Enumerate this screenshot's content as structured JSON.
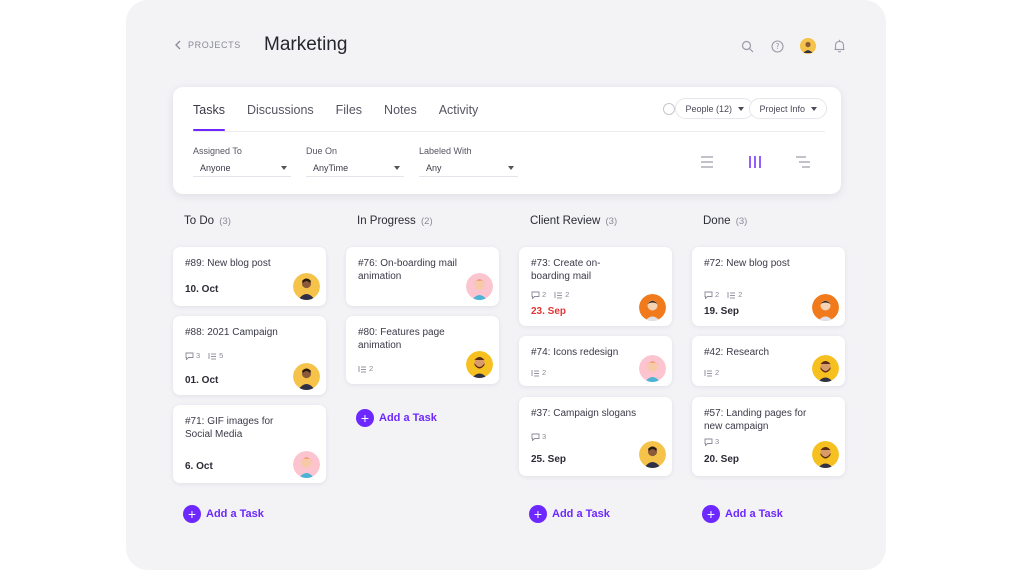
{
  "header": {
    "back_label": "PROJECTS",
    "title": "Marketing"
  },
  "colors": {
    "accent": "#6d28ff",
    "overdue": "#e43535",
    "panel_bg": "#f3f3f6"
  },
  "icons": [
    "search-icon",
    "help-icon",
    "user-avatar",
    "bell-icon",
    "chevron-left-icon",
    "clock-icon",
    "list-view-icon",
    "board-view-icon",
    "timeline-view-icon",
    "comment-icon",
    "subtask-icon",
    "plus-icon"
  ],
  "toolbar": {
    "tabs": [
      {
        "label": "Tasks",
        "active": true
      },
      {
        "label": "Discussions",
        "active": false
      },
      {
        "label": "Files",
        "active": false
      },
      {
        "label": "Notes",
        "active": false
      },
      {
        "label": "Activity",
        "active": false
      }
    ],
    "people_pill": "People (12)",
    "info_pill": "Project Info",
    "filters": {
      "assigned": {
        "label": "Assigned To",
        "value": "Anyone"
      },
      "due": {
        "label": "Due On",
        "value": "AnyTime"
      },
      "labeled": {
        "label": "Labeled With",
        "value": "Any"
      }
    },
    "active_view": "board"
  },
  "columns": [
    {
      "title": "To Do",
      "count": "(3)",
      "cards": [
        {
          "title": "#89: New blog post",
          "comments": "",
          "subtasks": "",
          "date": "10. Oct",
          "overdue": false
        },
        {
          "title": "#88: 2021 Campaign",
          "comments": "3",
          "subtasks": "5",
          "date": "01. Oct",
          "overdue": false
        },
        {
          "title": "#71: GIF images for Social Media",
          "comments": "",
          "subtasks": "",
          "date": "6. Oct",
          "overdue": false
        }
      ],
      "add_label": "Add a Task"
    },
    {
      "title": "In Progress",
      "count": "(2)",
      "cards": [
        {
          "title": "#76: On-boarding mail animation",
          "comments": "",
          "subtasks": "",
          "date": "",
          "overdue": false
        },
        {
          "title": "#80: Features page animation",
          "comments": "",
          "subtasks": "2",
          "date": "",
          "overdue": false
        }
      ],
      "add_label": "Add a Task"
    },
    {
      "title": "Client Review",
      "count": "(3)",
      "cards": [
        {
          "title": "#73: Create on-boarding mail",
          "comments": "2",
          "subtasks": "2",
          "date": "23. Sep",
          "overdue": true
        },
        {
          "title": "#74: Icons redesign",
          "comments": "",
          "subtasks": "2",
          "date": "",
          "overdue": false
        },
        {
          "title": "#37: Campaign slogans",
          "comments": "3",
          "subtasks": "",
          "date": "25. Sep",
          "overdue": false
        }
      ],
      "add_label": "Add a Task"
    },
    {
      "title": "Done",
      "count": "(3)",
      "cards": [
        {
          "title": "#72: New blog post",
          "comments": "2",
          "subtasks": "2",
          "date": "19. Sep",
          "overdue": false
        },
        {
          "title": "#42: Research",
          "comments": "",
          "subtasks": "2",
          "date": "",
          "overdue": false
        },
        {
          "title": "#57: Landing pages for new campaign",
          "comments": "3",
          "subtasks": "",
          "date": "20. Sep",
          "overdue": false
        }
      ],
      "add_label": "Add a Task"
    }
  ]
}
